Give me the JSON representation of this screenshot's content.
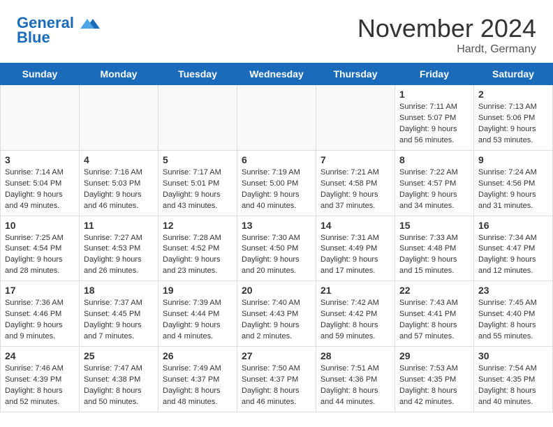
{
  "header": {
    "logo_line1": "General",
    "logo_line2": "Blue",
    "month_title": "November 2024",
    "location": "Hardt, Germany"
  },
  "days_of_week": [
    "Sunday",
    "Monday",
    "Tuesday",
    "Wednesday",
    "Thursday",
    "Friday",
    "Saturday"
  ],
  "weeks": [
    [
      {
        "day": "",
        "empty": true
      },
      {
        "day": "",
        "empty": true
      },
      {
        "day": "",
        "empty": true
      },
      {
        "day": "",
        "empty": true
      },
      {
        "day": "",
        "empty": true
      },
      {
        "day": "1",
        "sunrise": "Sunrise: 7:11 AM",
        "sunset": "Sunset: 5:07 PM",
        "daylight": "Daylight: 9 hours and 56 minutes."
      },
      {
        "day": "2",
        "sunrise": "Sunrise: 7:13 AM",
        "sunset": "Sunset: 5:06 PM",
        "daylight": "Daylight: 9 hours and 53 minutes."
      }
    ],
    [
      {
        "day": "3",
        "sunrise": "Sunrise: 7:14 AM",
        "sunset": "Sunset: 5:04 PM",
        "daylight": "Daylight: 9 hours and 49 minutes."
      },
      {
        "day": "4",
        "sunrise": "Sunrise: 7:16 AM",
        "sunset": "Sunset: 5:03 PM",
        "daylight": "Daylight: 9 hours and 46 minutes."
      },
      {
        "day": "5",
        "sunrise": "Sunrise: 7:17 AM",
        "sunset": "Sunset: 5:01 PM",
        "daylight": "Daylight: 9 hours and 43 minutes."
      },
      {
        "day": "6",
        "sunrise": "Sunrise: 7:19 AM",
        "sunset": "Sunset: 5:00 PM",
        "daylight": "Daylight: 9 hours and 40 minutes."
      },
      {
        "day": "7",
        "sunrise": "Sunrise: 7:21 AM",
        "sunset": "Sunset: 4:58 PM",
        "daylight": "Daylight: 9 hours and 37 minutes."
      },
      {
        "day": "8",
        "sunrise": "Sunrise: 7:22 AM",
        "sunset": "Sunset: 4:57 PM",
        "daylight": "Daylight: 9 hours and 34 minutes."
      },
      {
        "day": "9",
        "sunrise": "Sunrise: 7:24 AM",
        "sunset": "Sunset: 4:56 PM",
        "daylight": "Daylight: 9 hours and 31 minutes."
      }
    ],
    [
      {
        "day": "10",
        "sunrise": "Sunrise: 7:25 AM",
        "sunset": "Sunset: 4:54 PM",
        "daylight": "Daylight: 9 hours and 28 minutes."
      },
      {
        "day": "11",
        "sunrise": "Sunrise: 7:27 AM",
        "sunset": "Sunset: 4:53 PM",
        "daylight": "Daylight: 9 hours and 26 minutes."
      },
      {
        "day": "12",
        "sunrise": "Sunrise: 7:28 AM",
        "sunset": "Sunset: 4:52 PM",
        "daylight": "Daylight: 9 hours and 23 minutes."
      },
      {
        "day": "13",
        "sunrise": "Sunrise: 7:30 AM",
        "sunset": "Sunset: 4:50 PM",
        "daylight": "Daylight: 9 hours and 20 minutes."
      },
      {
        "day": "14",
        "sunrise": "Sunrise: 7:31 AM",
        "sunset": "Sunset: 4:49 PM",
        "daylight": "Daylight: 9 hours and 17 minutes."
      },
      {
        "day": "15",
        "sunrise": "Sunrise: 7:33 AM",
        "sunset": "Sunset: 4:48 PM",
        "daylight": "Daylight: 9 hours and 15 minutes."
      },
      {
        "day": "16",
        "sunrise": "Sunrise: 7:34 AM",
        "sunset": "Sunset: 4:47 PM",
        "daylight": "Daylight: 9 hours and 12 minutes."
      }
    ],
    [
      {
        "day": "17",
        "sunrise": "Sunrise: 7:36 AM",
        "sunset": "Sunset: 4:46 PM",
        "daylight": "Daylight: 9 hours and 9 minutes."
      },
      {
        "day": "18",
        "sunrise": "Sunrise: 7:37 AM",
        "sunset": "Sunset: 4:45 PM",
        "daylight": "Daylight: 9 hours and 7 minutes."
      },
      {
        "day": "19",
        "sunrise": "Sunrise: 7:39 AM",
        "sunset": "Sunset: 4:44 PM",
        "daylight": "Daylight: 9 hours and 4 minutes."
      },
      {
        "day": "20",
        "sunrise": "Sunrise: 7:40 AM",
        "sunset": "Sunset: 4:43 PM",
        "daylight": "Daylight: 9 hours and 2 minutes."
      },
      {
        "day": "21",
        "sunrise": "Sunrise: 7:42 AM",
        "sunset": "Sunset: 4:42 PM",
        "daylight": "Daylight: 8 hours and 59 minutes."
      },
      {
        "day": "22",
        "sunrise": "Sunrise: 7:43 AM",
        "sunset": "Sunset: 4:41 PM",
        "daylight": "Daylight: 8 hours and 57 minutes."
      },
      {
        "day": "23",
        "sunrise": "Sunrise: 7:45 AM",
        "sunset": "Sunset: 4:40 PM",
        "daylight": "Daylight: 8 hours and 55 minutes."
      }
    ],
    [
      {
        "day": "24",
        "sunrise": "Sunrise: 7:46 AM",
        "sunset": "Sunset: 4:39 PM",
        "daylight": "Daylight: 8 hours and 52 minutes."
      },
      {
        "day": "25",
        "sunrise": "Sunrise: 7:47 AM",
        "sunset": "Sunset: 4:38 PM",
        "daylight": "Daylight: 8 hours and 50 minutes."
      },
      {
        "day": "26",
        "sunrise": "Sunrise: 7:49 AM",
        "sunset": "Sunset: 4:37 PM",
        "daylight": "Daylight: 8 hours and 48 minutes."
      },
      {
        "day": "27",
        "sunrise": "Sunrise: 7:50 AM",
        "sunset": "Sunset: 4:37 PM",
        "daylight": "Daylight: 8 hours and 46 minutes."
      },
      {
        "day": "28",
        "sunrise": "Sunrise: 7:51 AM",
        "sunset": "Sunset: 4:36 PM",
        "daylight": "Daylight: 8 hours and 44 minutes."
      },
      {
        "day": "29",
        "sunrise": "Sunrise: 7:53 AM",
        "sunset": "Sunset: 4:35 PM",
        "daylight": "Daylight: 8 hours and 42 minutes."
      },
      {
        "day": "30",
        "sunrise": "Sunrise: 7:54 AM",
        "sunset": "Sunset: 4:35 PM",
        "daylight": "Daylight: 8 hours and 40 minutes."
      }
    ]
  ]
}
